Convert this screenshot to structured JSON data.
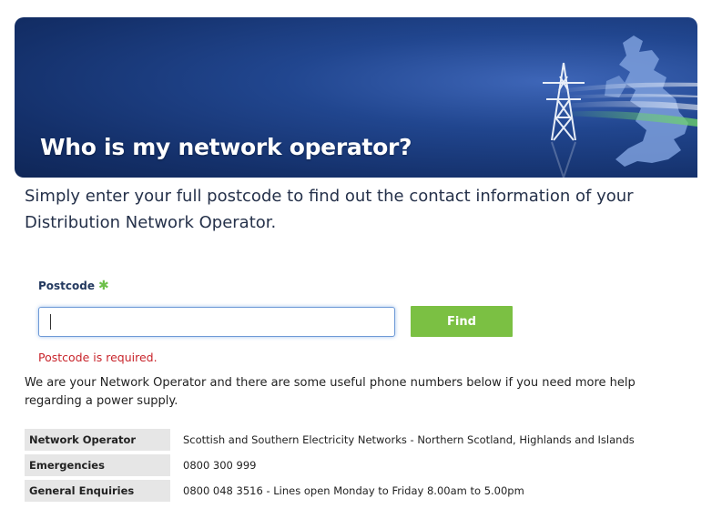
{
  "banner": {
    "title": "Who is my network operator?"
  },
  "intro": "Simply enter your full postcode to find out the contact information of your Distribution Network Operator.",
  "form": {
    "label": "Postcode",
    "required_marker": "✱",
    "value": "",
    "button_label": "Find",
    "error": "Postcode is required."
  },
  "result_note": "We are your Network Operator and there are some useful phone numbers below if you need more help regarding a power supply.",
  "contacts": [
    {
      "label": "Network Operator",
      "value": "Scottish and Southern Electricity Networks - Northern Scotland, Highlands and Islands"
    },
    {
      "label": "Emergencies",
      "value": "0800 300 999"
    },
    {
      "label": "General Enquiries",
      "value": "0800 048 3516 - Lines open Monday to Friday 8.00am to 5.00pm"
    }
  ],
  "colors": {
    "banner_dark": "#14306a",
    "accent_green": "#7bc043",
    "error_red": "#c8242b"
  },
  "icons": [
    "pylon-icon",
    "uk-map-icon"
  ]
}
